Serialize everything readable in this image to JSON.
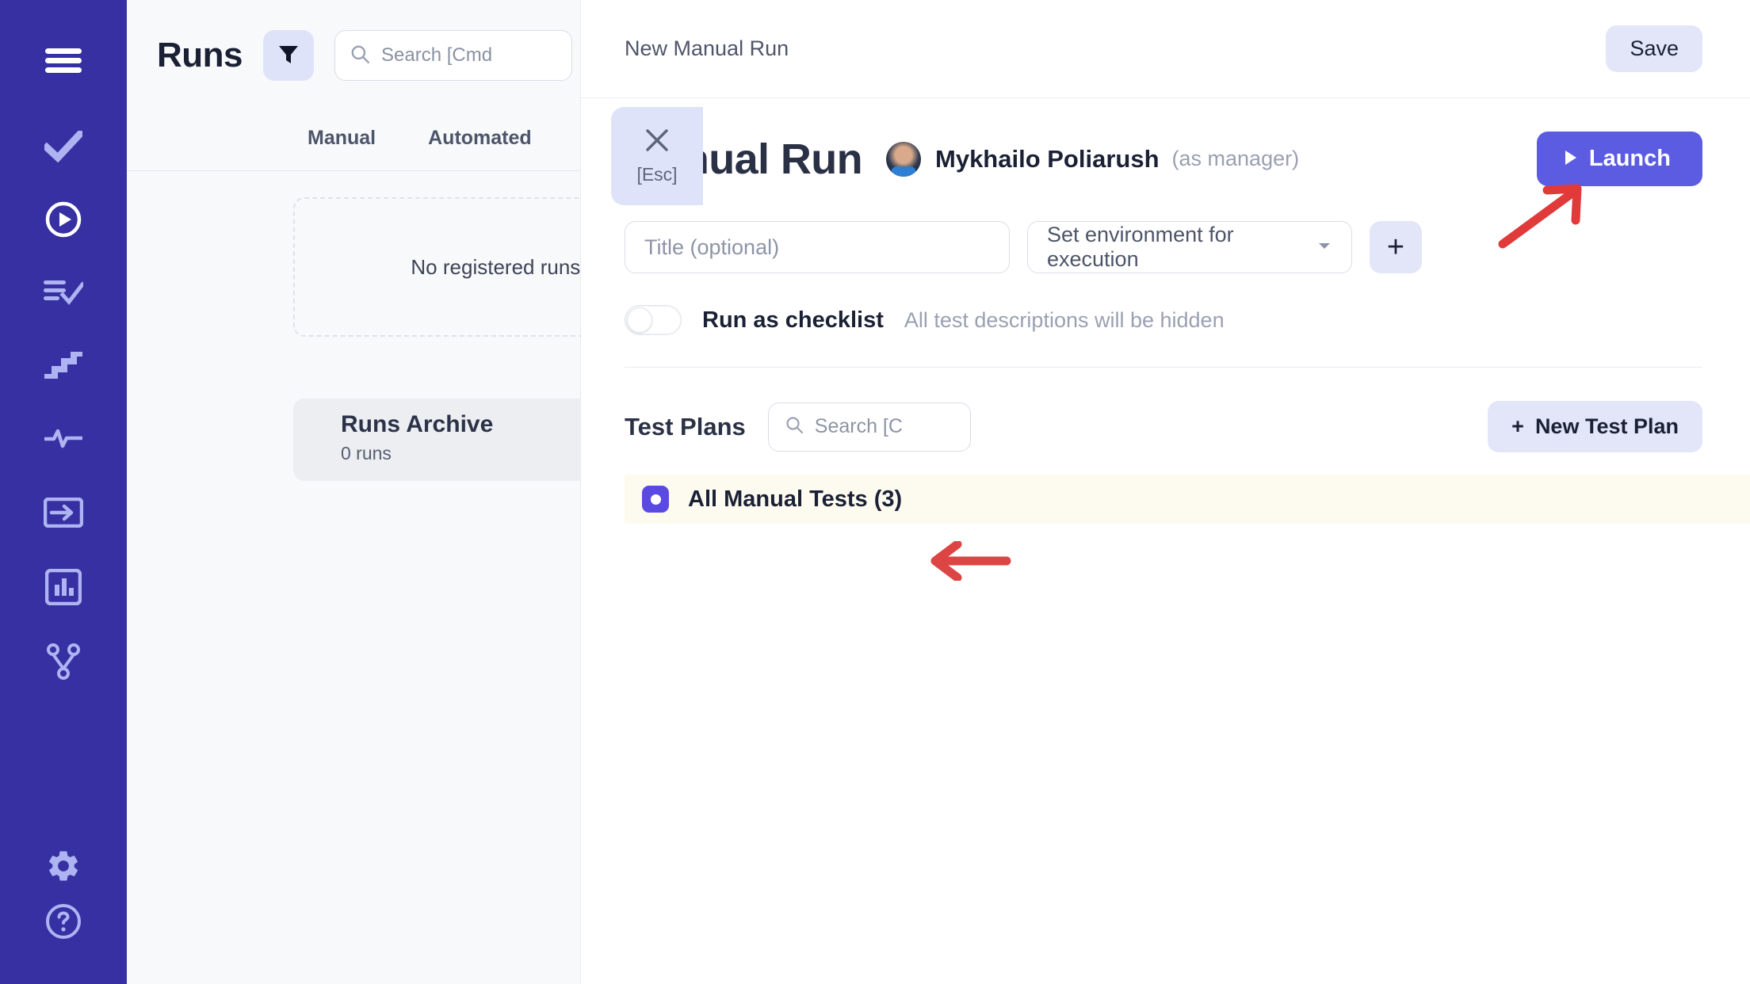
{
  "sidebar": {
    "items": [
      {
        "name": "menu-icon",
        "label": "Menu"
      },
      {
        "name": "check-icon",
        "label": "Tests"
      },
      {
        "name": "play-circle-icon",
        "label": "Runs"
      },
      {
        "name": "list-check-icon",
        "label": "Test Plans"
      },
      {
        "name": "stairs-icon",
        "label": "Milestones"
      },
      {
        "name": "pulse-icon",
        "label": "Activity"
      },
      {
        "name": "import-icon",
        "label": "Import"
      },
      {
        "name": "chart-icon",
        "label": "Reports"
      },
      {
        "name": "branch-icon",
        "label": "Integrations"
      },
      {
        "name": "gear-icon",
        "label": "Settings"
      },
      {
        "name": "help-icon",
        "label": "Help"
      }
    ]
  },
  "left_panel": {
    "title": "Runs",
    "filter_icon": "filter-icon",
    "search": {
      "icon": "search-icon",
      "placeholder": "Search [Cmd"
    },
    "close_overlay": {
      "icon": "close-icon",
      "label": "[Esc]"
    },
    "tabs": [
      {
        "label": "Manual"
      },
      {
        "label": "Automated"
      }
    ],
    "empty_state": "No registered runs yet. Yo",
    "archive": {
      "title": "Runs Archive",
      "count": "0 runs"
    }
  },
  "right_panel": {
    "breadcrumb": "New Manual Run",
    "save_label": "Save",
    "heading": "Manual Run",
    "user_name": "Mykhailo Poliarush",
    "user_role": "(as manager)",
    "launch_label": "Launch",
    "launch_icon": "play-icon",
    "title_field": {
      "placeholder": "Title (optional)",
      "value": ""
    },
    "environment_field": {
      "value": "Set environment for execution",
      "chevron": "chevron-down-icon"
    },
    "add_button": {
      "icon": "plus-icon"
    },
    "checklist_toggle": {
      "state": "off",
      "label": "Run as checklist",
      "hint": "All test descriptions will be hidden"
    },
    "test_plans": {
      "title": "Test Plans",
      "search": {
        "icon": "search-icon",
        "placeholder": "Search [C"
      },
      "new_button": {
        "label": "New Test Plan",
        "icon": "plus-icon"
      },
      "items": [
        {
          "label": "All Manual Tests (3)",
          "selected": true
        }
      ]
    }
  },
  "annotations": [
    {
      "name": "arrow-to-launch-button",
      "direction": "up-right",
      "color": "#e03a3a"
    },
    {
      "name": "arrow-to-test-plan-row",
      "direction": "left",
      "color": "#e04a4a"
    }
  ],
  "colors": {
    "sidebar": "#3730a3",
    "accent": "#5b5ce2",
    "accent_soft": "#e2e6f8",
    "highlight_row": "#fdfaef",
    "annotation": "#e03a3a"
  }
}
